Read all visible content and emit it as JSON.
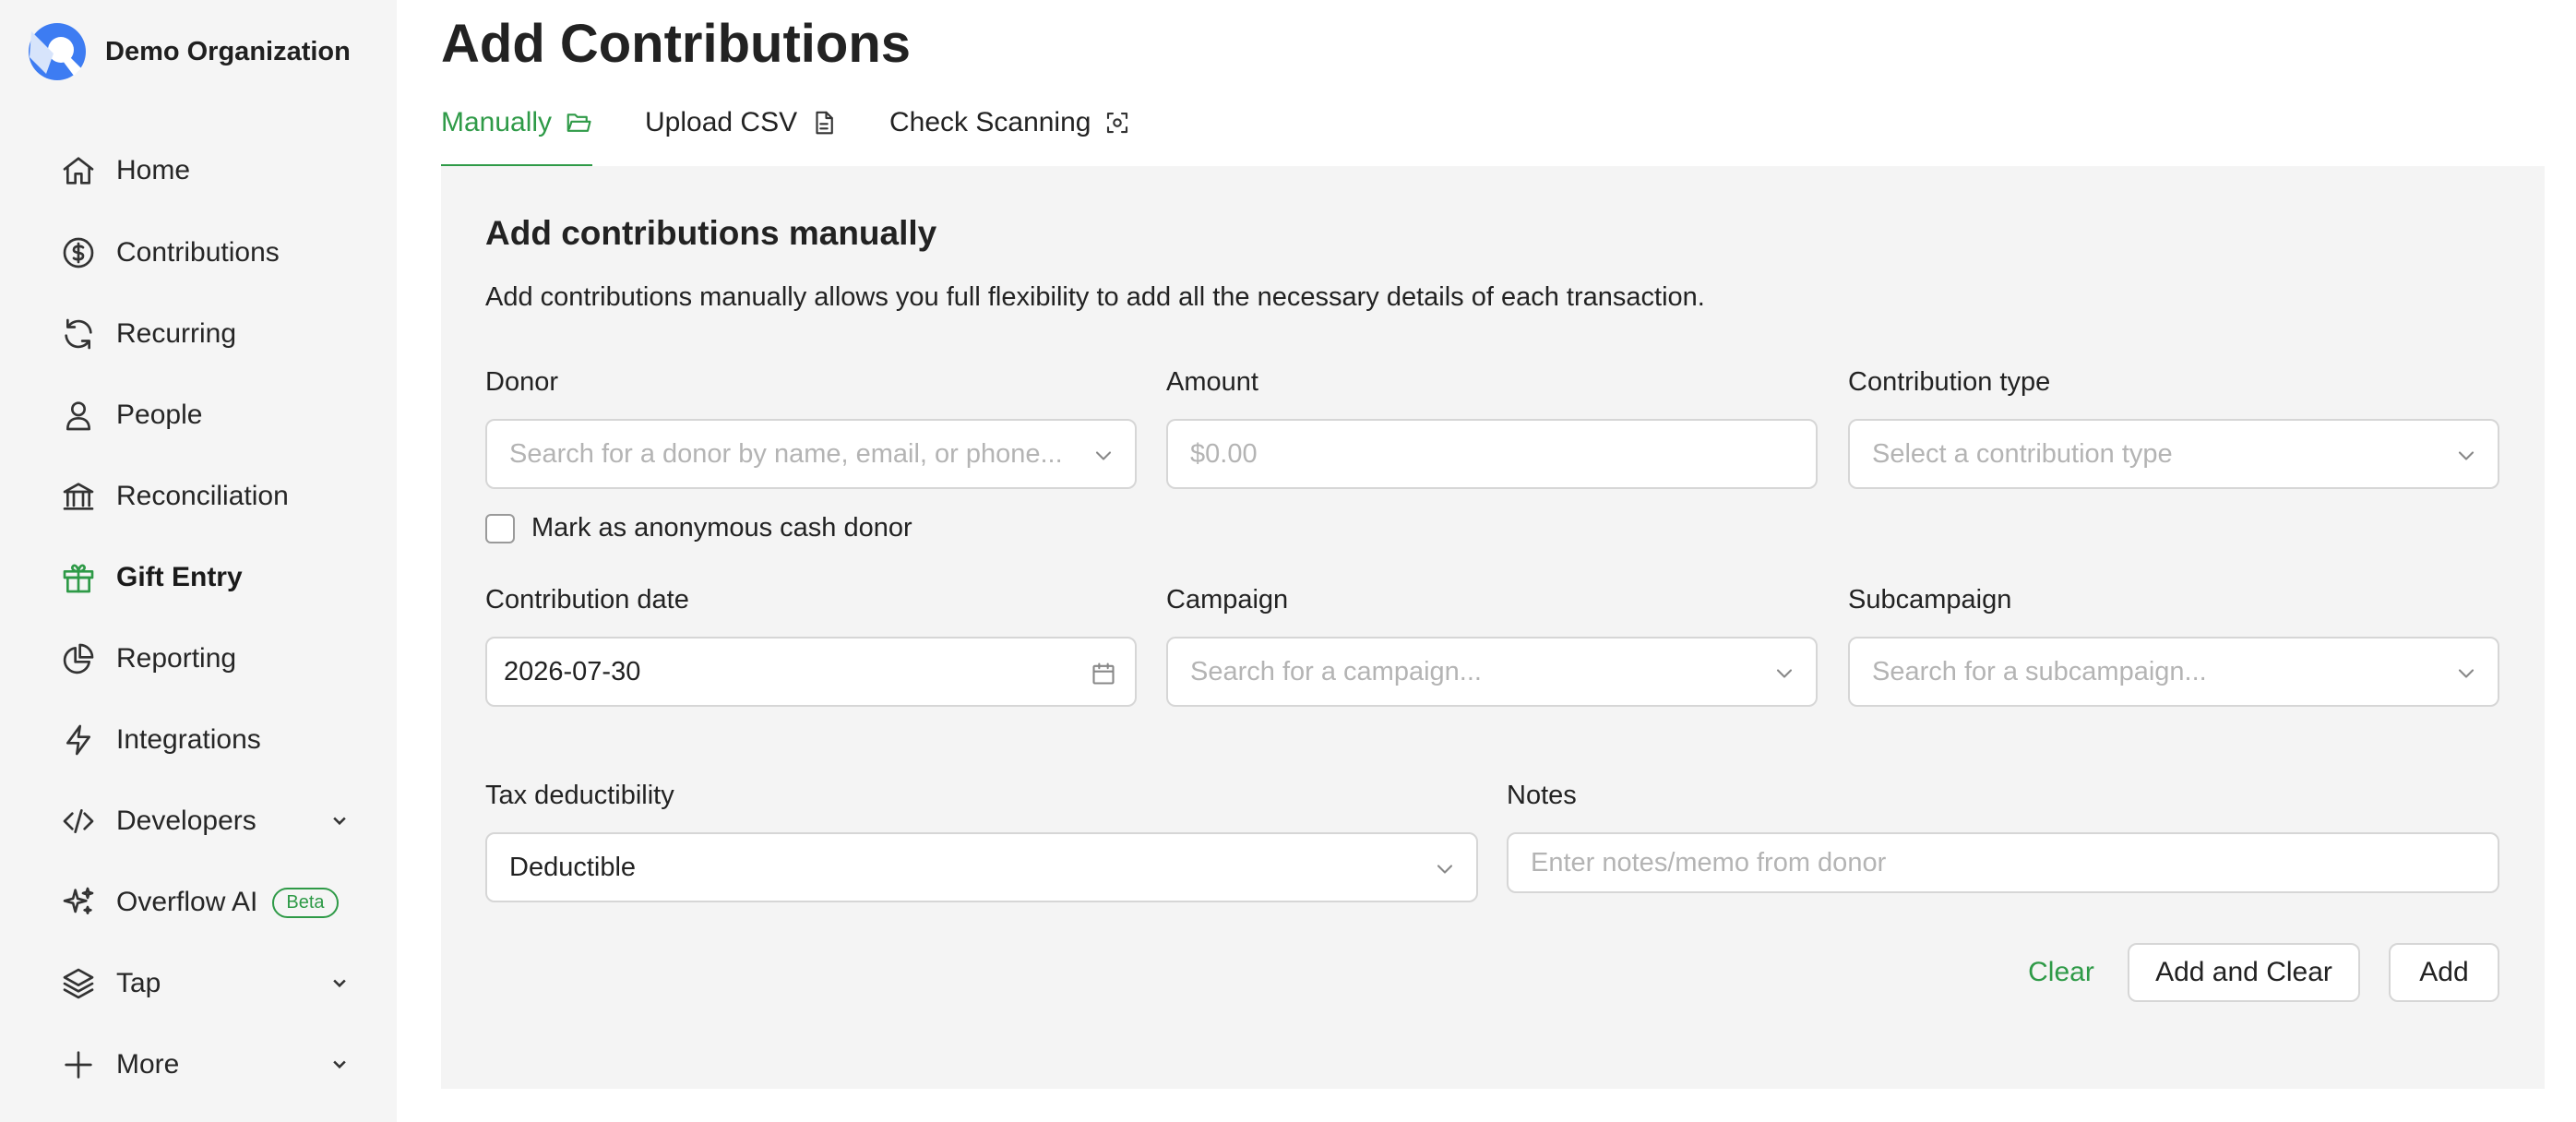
{
  "org": {
    "name": "Demo Organization"
  },
  "sidebar": {
    "items": [
      {
        "label": "Home",
        "icon": "home-icon"
      },
      {
        "label": "Contributions",
        "icon": "dollar-circle-icon"
      },
      {
        "label": "Recurring",
        "icon": "refresh-icon"
      },
      {
        "label": "People",
        "icon": "person-icon"
      },
      {
        "label": "Reconciliation",
        "icon": "bank-icon"
      },
      {
        "label": "Gift Entry",
        "icon": "gift-icon",
        "active": true
      },
      {
        "label": "Reporting",
        "icon": "pie-chart-icon"
      },
      {
        "label": "Integrations",
        "icon": "lightning-icon"
      },
      {
        "label": "Developers",
        "icon": "code-icon",
        "expandable": true
      },
      {
        "label": "Overflow AI",
        "icon": "sparkles-icon",
        "badge": "Beta"
      },
      {
        "label": "Tap",
        "icon": "layers-icon",
        "expandable": true
      },
      {
        "label": "More",
        "icon": "plus-icon",
        "expandable": true
      }
    ]
  },
  "page": {
    "title": "Add Contributions"
  },
  "tabs": [
    {
      "label": "Manually",
      "icon": "folder-icon",
      "active": true
    },
    {
      "label": "Upload CSV",
      "icon": "file-icon"
    },
    {
      "label": "Check Scanning",
      "icon": "scan-icon"
    }
  ],
  "form": {
    "title": "Add contributions manually",
    "description": "Add contributions manually allows you full flexibility to add all the necessary details of each transaction.",
    "donor": {
      "label": "Donor",
      "placeholder": "Search for a donor by name, email, or phone..."
    },
    "amount": {
      "label": "Amount",
      "placeholder": "$0.00"
    },
    "contribution_type": {
      "label": "Contribution type",
      "placeholder": "Select a contribution type"
    },
    "anonymous": {
      "label": "Mark as anonymous cash donor",
      "checked": false
    },
    "contribution_date": {
      "label": "Contribution date",
      "value": "2026-07-30"
    },
    "campaign": {
      "label": "Campaign",
      "placeholder": "Search for a campaign..."
    },
    "subcampaign": {
      "label": "Subcampaign",
      "placeholder": "Search for a subcampaign..."
    },
    "tax_deductibility": {
      "label": "Tax deductibility",
      "value": "Deductible"
    },
    "notes": {
      "label": "Notes",
      "placeholder": "Enter notes/memo from donor"
    },
    "buttons": {
      "clear": "Clear",
      "add_and_clear": "Add and Clear",
      "add": "Add"
    }
  },
  "colors": {
    "accent": "#2e9a47",
    "logo": "#3d7cf2",
    "panel_bg": "#f4f4f4",
    "sidebar_bg": "#f5f5f5"
  }
}
